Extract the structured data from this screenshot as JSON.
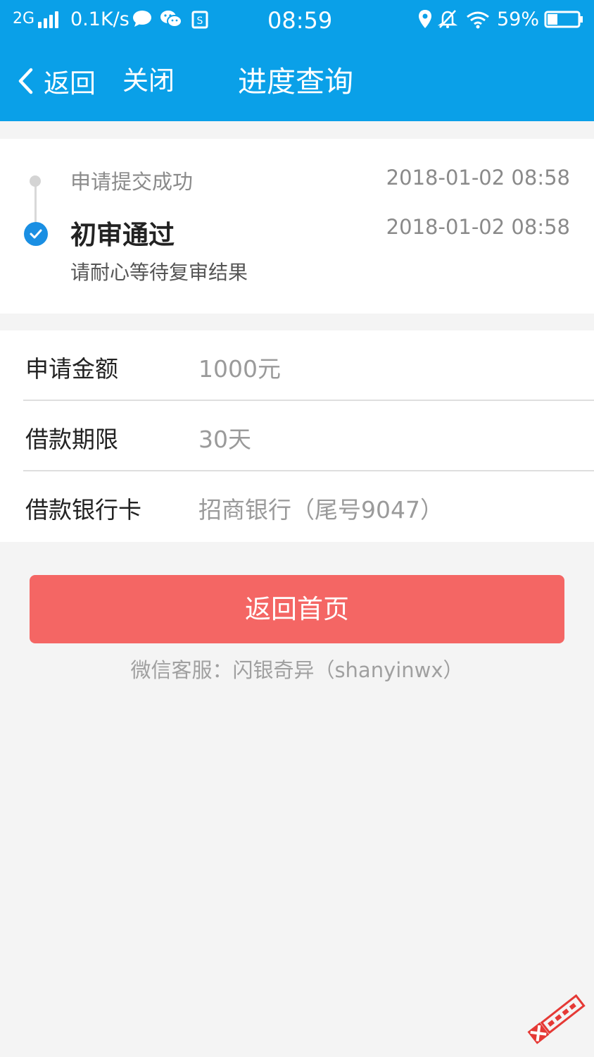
{
  "status_bar": {
    "network": "2G",
    "speed": "0.1K/s",
    "time": "08:59",
    "battery": "59%",
    "icons": [
      "signal-icon",
      "chat-bubble-icon",
      "wechat-icon",
      "sim-icon",
      "location-icon",
      "bell-muted-icon",
      "wifi-icon",
      "battery-icon"
    ]
  },
  "nav": {
    "back_label": "返回",
    "close_label": "关闭",
    "title": "进度查询"
  },
  "progress": {
    "steps": [
      {
        "label": "申请提交成功",
        "time": "2018-01-02 08:58",
        "state": "done"
      },
      {
        "label": "初审通过",
        "time": "2018-01-02 08:58",
        "state": "current",
        "description": "请耐心等待复审结果"
      }
    ]
  },
  "details": [
    {
      "label": "申请金额",
      "value": "1000元"
    },
    {
      "label": "借款期限",
      "value": "30天"
    },
    {
      "label": "借款银行卡",
      "value": "招商银行（尾号9047）"
    }
  ],
  "actions": {
    "home_button_label": "返回首页"
  },
  "footer": {
    "service_text": "微信客服：闪银奇异（shanyinwx）"
  },
  "colors": {
    "header_blue": "#0aa0e8",
    "button_red": "#f46664",
    "check_blue": "#1a8fe3",
    "background": "#f4f4f4"
  }
}
